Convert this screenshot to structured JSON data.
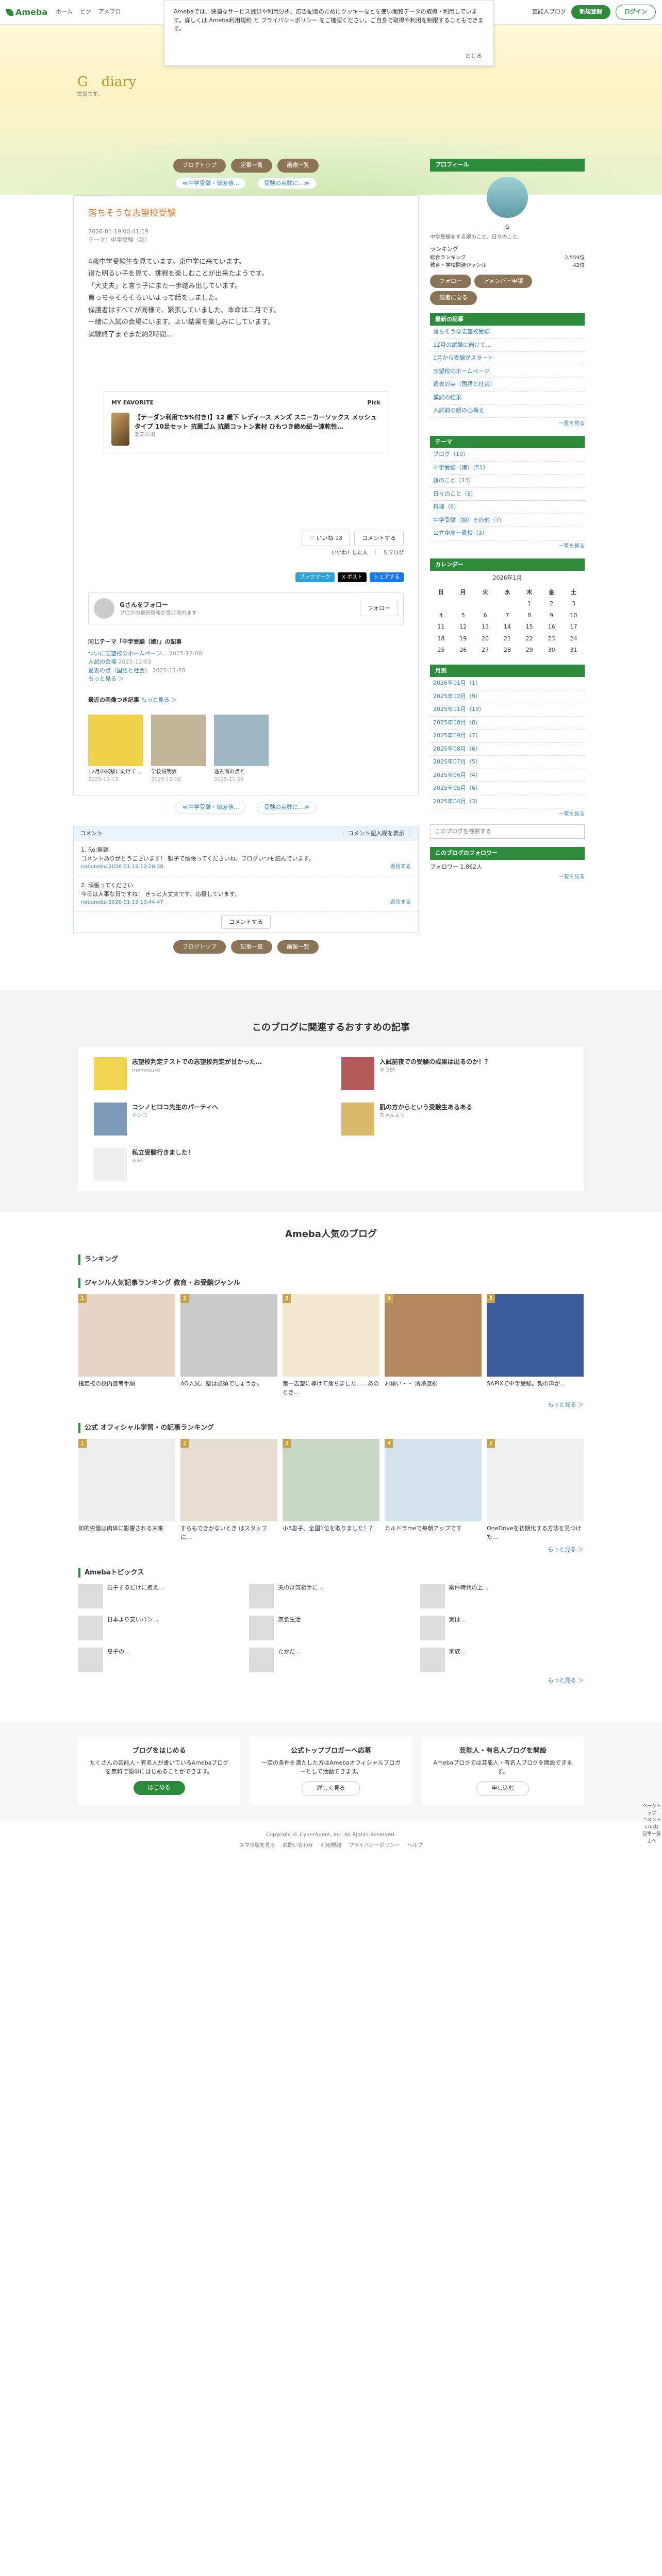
{
  "topbar": {
    "logo": "Ameba",
    "nav": [
      "ホーム",
      "ピグ",
      "アメブロ"
    ],
    "links": [
      "芸能人ブログ",
      "人気ブログ"
    ],
    "register": "新規登録",
    "login": "ログイン"
  },
  "cookie": {
    "text": "Amebaでは、快適なサービス提供や利用分析、広告配信のためにクッキーなどを使い閲覧データの取得・利用しています。詳しくは Ameba利用規約 と プライバシーポリシー をご確認ください。ご自身で取得や利用を制限することもできます。",
    "close": "とじる"
  },
  "header": {
    "title": "G　diary",
    "subtitle": "文鎮です。"
  },
  "tabs": [
    "ブログトップ",
    "記事一覧",
    "画像一覧"
  ],
  "pager": {
    "prev": "≪中学受験・偏差値…",
    "next": "受験の点数に…≫"
  },
  "entry": {
    "title": "落ちそうな志望校受験",
    "date": "2026-01-19 00:41:19",
    "theme": "テーマ：中学受験（娘）",
    "body": [
      "4歳中学受験生を見ています。東中学に来ています。",
      "得た明るい子を見て、挑戦を楽しむことが出来たようです。",
      "「大丈夫」と言う子にまた一歩踏み出しています。",
      "首っちゃそろそろいいよって話をしました。",
      "",
      "保護者はすべてが同様で、緊張していました。本命は二月です。",
      "一緒に入試の会場にいます。よい結果を楽しみにしています。",
      "試験終了までまだ約2時間…"
    ]
  },
  "favorite": {
    "label": "MY FAVORITE",
    "badge": "Pick",
    "item": "【テーダン利用で5%付き!】12 歳下 レディース メンズ スニーカーソックス メッシュタイプ 10足セット 抗菌ゴム 抗菌コットン素材 ひもつき締め紐～速乾性…",
    "shop": "楽天市場"
  },
  "like": {
    "label": "いいね",
    "count": "13",
    "comment": "コメントする"
  },
  "reblog": "いいね！した人　｜　リブログ",
  "share": [
    "ブックマーク",
    "X ポスト",
    "シェアする"
  ],
  "follow": {
    "name": "Gさんをフォロー",
    "desc": "ブログの更新情報が受け取れます",
    "button": "フォロー"
  },
  "themeList": {
    "heading": "同じテーマ「中学受験（娘）」の記事",
    "items": [
      {
        "title": "ついに志望校のホームページ…",
        "date": "2025-12-08"
      },
      {
        "title": "入試の会場",
        "date": "2025-12-03"
      },
      {
        "title": "過去の点（国語と社会）",
        "date": "2025-11-28"
      }
    ],
    "more": "もっと見る ＞"
  },
  "recentImages": {
    "heading": "最近の画像つき記事",
    "more": "もっと見る ＞",
    "items": [
      {
        "title": "12月の試験に向けて…",
        "date": "2025-12-13"
      },
      {
        "title": "学校説明会",
        "date": "2025-12-08"
      },
      {
        "title": "過去問の点と",
        "date": "2025-11-28"
      }
    ]
  },
  "comments": {
    "heading": "コメント",
    "more": "｜ コメント記入欄を表示 ｜",
    "items": [
      {
        "title": "1. Re:無題",
        "text": "コメントありがとうございます！ 親子で頑張ってくださいね。ブログいつも読んでいます。",
        "name": "nabunobu",
        "date": "2026-01-19 10:20:38",
        "reply": "返信する"
      },
      {
        "title": "2. 頑張ってください",
        "text": "今日は大事な日ですね！ きっと大丈夫です、応援しています。",
        "name": "nabunobu",
        "date": "2026-01-19 10:44:47",
        "reply": "返信する"
      }
    ],
    "write": "コメントする"
  },
  "profile": {
    "heading": "プロフィール",
    "name": "G",
    "bio": "中学受験をする娘のこと、日々のこと。",
    "rankLabel": "ランキング",
    "ranks": [
      {
        "k": "総合ランキング",
        "v": "2,559位"
      },
      {
        "k": "教育・学校関連ジャンル",
        "v": "42位"
      }
    ],
    "buttons": [
      "フォロー",
      "アメンバー申請"
    ],
    "readers": "読者になる"
  },
  "recent": {
    "heading": "最新の記事",
    "items": [
      "落ちそうな志望校受験",
      "12月の試験に向けて…",
      "1月から受験がスタート",
      "志望校のホームページ",
      "過去の点（国語と社会）",
      "模試の結果",
      "入試前の親の心構え"
    ],
    "more": "一覧を見る"
  },
  "themes": {
    "heading": "テーマ",
    "items": [
      "ブログ（10）",
      "中学受験（娘）（51）",
      "娘のこと（13）",
      "日々のこと（8）",
      "料理（6）",
      "中学受験（娘）その他（7）",
      "公立中高一貫校（3）"
    ],
    "more": "一覧を見る"
  },
  "calendar": {
    "heading": "カレンダー",
    "month": "2026年1月",
    "weekdays": [
      "日",
      "月",
      "火",
      "水",
      "木",
      "金",
      "土"
    ],
    "weeks": [
      [
        "",
        "",
        "",
        "",
        "1",
        "2",
        "3"
      ],
      [
        "4",
        "5",
        "6",
        "7",
        "8",
        "9",
        "10"
      ],
      [
        "11",
        "12",
        "13",
        "14",
        "15",
        "16",
        "17"
      ],
      [
        "18",
        "19",
        "20",
        "21",
        "22",
        "23",
        "24"
      ],
      [
        "25",
        "26",
        "27",
        "28",
        "29",
        "30",
        "31"
      ]
    ]
  },
  "archive": {
    "heading": "月別",
    "items": [
      "2026年01月（1）",
      "2025年12月（9）",
      "2025年11月（13）",
      "2025年10月（8）",
      "2025年09月（7）",
      "2025年08月（6）",
      "2025年07月（5）",
      "2025年06月（4）",
      "2025年05月（6）",
      "2025年04月（3）"
    ],
    "more": "一覧を見る"
  },
  "search": {
    "placeholder": "このブログを検索する"
  },
  "followList": {
    "heading": "このブログのフォロワー",
    "count": "フォロワー 1,862人",
    "more": "一覧を見る"
  },
  "recommend": {
    "heading": "このブログに関連するおすすめの記事",
    "items": [
      {
        "title": "志望校判定テストでの志望校判定が甘かった…",
        "user": "momosuke"
      },
      {
        "title": "入試前夜での受験の成果は出るのか！？",
        "user": "ゆう姉"
      },
      {
        "title": "コシノヒロコ先生のパーティへ",
        "user": "キンコ"
      },
      {
        "title": "肌の方からという受験生あるある",
        "user": "ちゃんよう"
      },
      {
        "title": "私立受験行きました！",
        "user": "ai44"
      }
    ]
  },
  "popular": {
    "heading": "Ameba人気のブログ",
    "rankingLabel": "ランキング",
    "genreHeading": "ジャンル人気記事ランキング 教育・お受験ジャンル",
    "genreItems": [
      "指定校の校内選考手順",
      "AO入試、塾は必須でしょうか。",
      "第一志望に導けて落ちました……あのとき…",
      "お願い・・ 清浄選択",
      "SAPIXで中学受験。親の声が…"
    ],
    "officialHeading": "公式 オフィシャル学習・の記事ランキング",
    "officialItems": [
      "知的労働は肉体に影響される未来",
      "すらもできかないとき はスタッフに…",
      "小3息子、全国1位を取りました！？",
      "カルドラmeで毎朝アップです",
      "OneDriveを初期化する方法を見つけた…"
    ],
    "more": "もっと見る ＞",
    "topicsHeading": "Amebaトピックス",
    "topics": [
      "妊子するだけに抱え…",
      "夫の浮気相手に…",
      "案件時代の上…",
      "日本より安いパン…",
      "無食生活",
      "実は…",
      "息子の…",
      "たかだ…",
      "家族…"
    ]
  },
  "cta": [
    {
      "title": "ブログをはじめる",
      "text": "たくさんの芸能人・有名人が書いているAmebaブログを無料で簡単にはじめることができます。",
      "button": "はじめる"
    },
    {
      "title": "公式トップブロガーへ応募",
      "text": "一定の条件を満たした方はAmebaオフィシャルブロガーとして活動できます。",
      "button": "詳しく見る"
    },
    {
      "title": "芸能人・有名人ブログを開設",
      "text": "Amebaブログでは芸能人・有名人ブログを開設できます。",
      "button": "申し込む"
    }
  ],
  "footer": {
    "links": [
      "スマホ版を見る",
      "お問い合わせ",
      "利用規約",
      "プライバシーポリシー",
      "ヘルプ"
    ],
    "copyright": "Copyright © CyberAgent, Inc. All Rights Reserved."
  },
  "float": [
    "ページトップ",
    "コメント",
    "いいね",
    "記事一覧",
    "上へ"
  ]
}
